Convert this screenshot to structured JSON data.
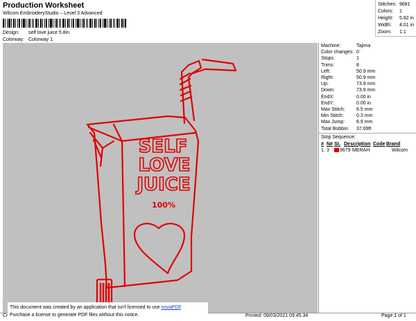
{
  "header": {
    "title": "Production Worksheet",
    "subtitle": "Wilcom EmbroideryStudio – Level 3 Advanced",
    "design_label": "Design:",
    "design_value": "self love juice 5.8in",
    "colorway_label": "Colorway:",
    "colorway_value": "Colorway 1"
  },
  "stats": [
    {
      "label": "Stitches:",
      "value": "9681"
    },
    {
      "label": "Colors:",
      "value": "1"
    },
    {
      "label": "Height:",
      "value": "5.82 in"
    },
    {
      "label": "Width:",
      "value": "4.01 in"
    },
    {
      "label": "Zoom:",
      "value": "1:1"
    }
  ],
  "machine_info": [
    {
      "label": "Machine:",
      "value": "Tajima"
    },
    {
      "label": "Color changes:",
      "value": "0"
    },
    {
      "label": "Stops:",
      "value": "1"
    },
    {
      "label": "Trims:",
      "value": "8"
    },
    {
      "label": "Left:",
      "value": "50.9 mm"
    },
    {
      "label": "Right:",
      "value": "50.9 mm"
    },
    {
      "label": "Up:",
      "value": "73.9 mm"
    },
    {
      "label": "Down:",
      "value": "73.9 mm"
    },
    {
      "label": "EndX:",
      "value": "0.00 in"
    },
    {
      "label": "EndY:",
      "value": "0.00 in"
    },
    {
      "label": "Max Stitch:",
      "value": "6.5 mm"
    },
    {
      "label": "Min Stitch:",
      "value": "0.3 mm"
    },
    {
      "label": "Max Jump:",
      "value": "6.9 mm"
    },
    {
      "label": "Total Bobbin:",
      "value": "37.69ft"
    }
  ],
  "stop_sequence": {
    "heading": "Stop Sequence:",
    "columns": [
      "#",
      "N#",
      "St.",
      "Description",
      "Code",
      "Brand"
    ],
    "rows": [
      {
        "num": "1.",
        "n": "3",
        "stitches": "9679",
        "description": "MERAH",
        "code": "",
        "brand": "Wilcom",
        "color": "#d80000"
      }
    ]
  },
  "design_art": {
    "text_lines": [
      "SELF",
      "LOVE",
      "JUICE"
    ],
    "percent": "100%",
    "thread_color": "#e00000"
  },
  "footer": {
    "left": "Cr",
    "printed": "Printed: 09/03/2021 09:45.34",
    "page": "Page 1 of 1"
  },
  "notice": {
    "line1": "This document was created by an application that isn't licensed to use",
    "link": "novaPDF",
    "line1_end": ".",
    "line2": "Purchase a license to generate PDF files without this notice."
  }
}
